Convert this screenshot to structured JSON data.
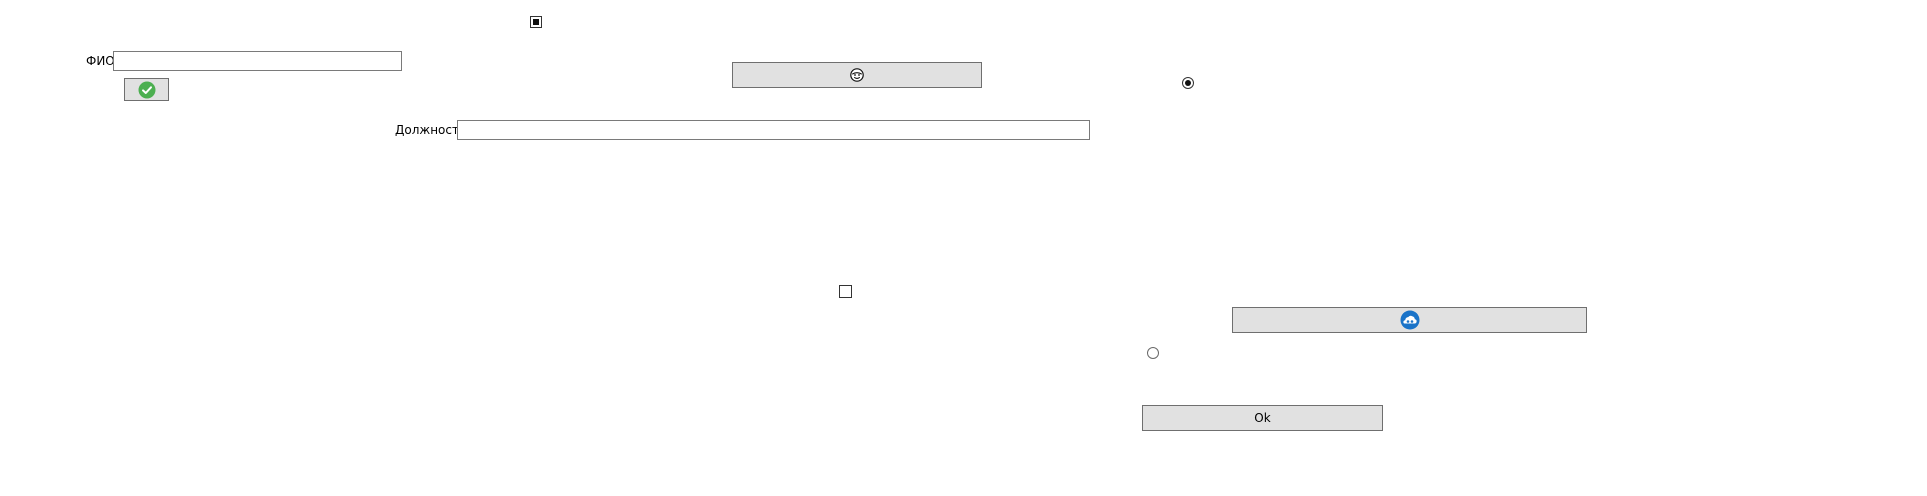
{
  "form": {
    "fio_label": "ФИО",
    "fio_value": "",
    "position_label": "Должность",
    "position_value": "",
    "ok_button_label": "Ok"
  },
  "icons": {
    "confirm_button_icon": "green-checkmark-circle-icon",
    "emoji_button_icon": "face-icon",
    "cloud_button_icon": "blue-cloud-circle-icon"
  },
  "controls": {
    "top_checkbox": "indeterminate",
    "middle_checkbox": "unchecked",
    "upper_radio": "checked",
    "lower_radio": "unchecked"
  },
  "colors": {
    "button_bg": "#e1e1e1",
    "button_border": "#6f6f6f",
    "check_green": "#4caf50",
    "cloud_blue": "#1a73c8"
  }
}
